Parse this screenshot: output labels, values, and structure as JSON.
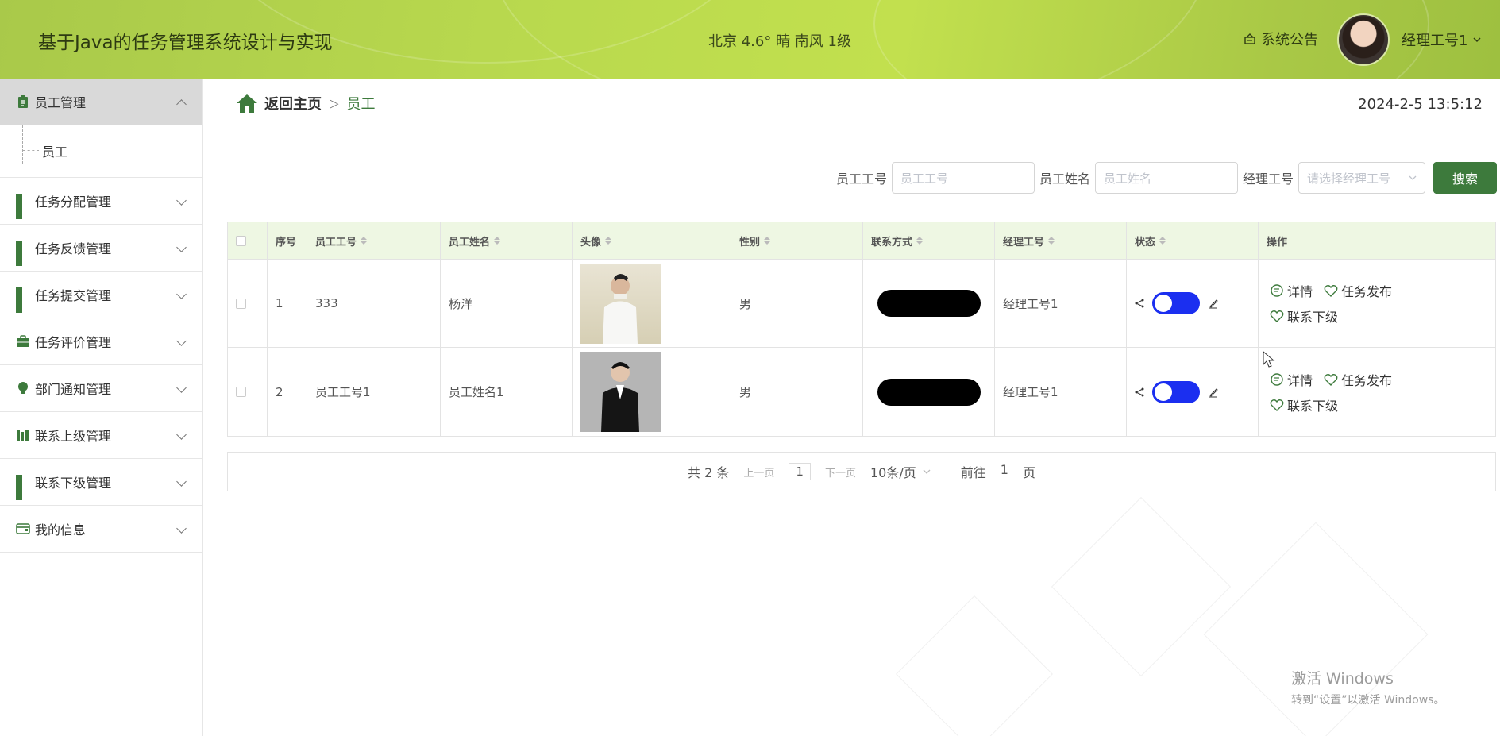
{
  "header": {
    "title": "基于Java的任务管理系统设计与实现",
    "weather": "北京  4.6°  晴  南风  1级",
    "notice_label": "系统公告",
    "user_label": "经理工号1"
  },
  "sidebar": {
    "items": [
      {
        "label": "员工管理",
        "expanded": true,
        "children": [
          {
            "label": "员工"
          }
        ]
      },
      {
        "label": "任务分配管理"
      },
      {
        "label": "任务反馈管理"
      },
      {
        "label": "任务提交管理"
      },
      {
        "label": "任务评价管理"
      },
      {
        "label": "部门通知管理"
      },
      {
        "label": "联系上级管理"
      },
      {
        "label": "联系下级管理"
      },
      {
        "label": "我的信息"
      }
    ]
  },
  "breadcrumb": {
    "home": "返回主页",
    "current": "员工"
  },
  "datetime": "2024-2-5 13:5:12",
  "search": {
    "fields": [
      {
        "label": "员工工号",
        "placeholder": "员工工号"
      },
      {
        "label": "员工姓名",
        "placeholder": "员工姓名"
      },
      {
        "label": "经理工号",
        "placeholder": "请选择经理工号"
      }
    ],
    "button": "搜索"
  },
  "table": {
    "columns": [
      "序号",
      "员工工号",
      "员工姓名",
      "头像",
      "性别",
      "联系方式",
      "经理工号",
      "状态",
      "操作"
    ],
    "rows": [
      {
        "index": "1",
        "emp_no": "333",
        "name": "杨洋",
        "gender": "男",
        "manager_no": "经理工号1"
      },
      {
        "index": "2",
        "emp_no": "员工工号1",
        "name": "员工姓名1",
        "gender": "男",
        "manager_no": "经理工号1"
      }
    ],
    "actions": {
      "detail": "详情",
      "publish": "任务发布",
      "contact": "联系下级"
    }
  },
  "pager": {
    "total": "共 2 条",
    "prev": "上一页",
    "page": "1",
    "next": "下一页",
    "page_size": "10条/页",
    "goto_prefix": "前往",
    "goto_value": "1",
    "goto_suffix": "页"
  },
  "watermark": {
    "line1": "激活 Windows",
    "line2": "转到“设置”以激活 Windows。"
  },
  "colors": {
    "brand": "#3d7a3c",
    "header": "#b9d94e",
    "toggle": "#1b2ff0",
    "table_header": "#eef7e3"
  }
}
